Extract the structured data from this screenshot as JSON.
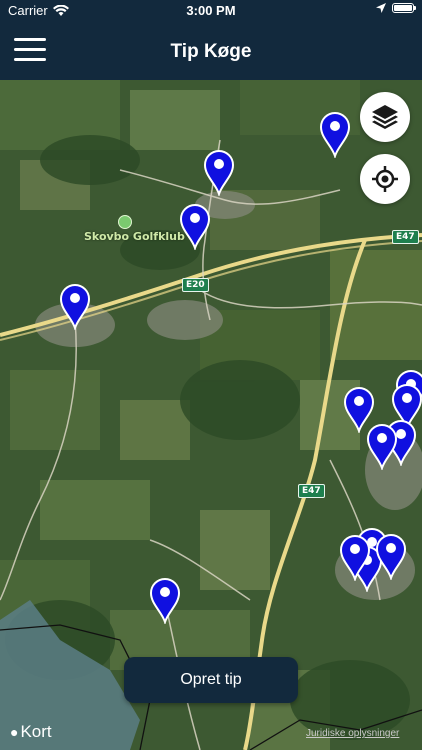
{
  "status_bar": {
    "carrier": "Carrier",
    "time": "3:00 PM",
    "battery_level": 1.0,
    "icons": [
      "wifi-icon",
      "location-arrow-icon",
      "battery-icon"
    ]
  },
  "nav": {
    "title": "Tip Køge",
    "menu_icon": "hamburger-menu-icon",
    "background": "#12293d"
  },
  "map": {
    "place_labels": [
      "Skovbo Golfklub"
    ],
    "road_shields": [
      "E47",
      "E20",
      "E47"
    ],
    "pin_color": "#1010e0",
    "pin_count": 14,
    "controls": [
      "layers-icon",
      "locate-icon"
    ]
  },
  "actions": {
    "create_tip_label": "Opret tip"
  },
  "attribution": {
    "maps_brand": "Kort",
    "legal_link": "Juridiske oplysninger"
  }
}
